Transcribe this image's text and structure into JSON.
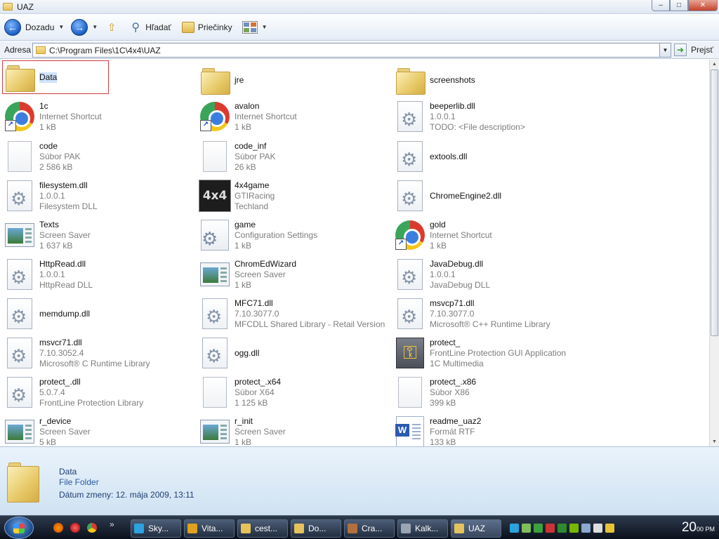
{
  "window": {
    "title": "UAZ"
  },
  "toolbar": {
    "back_label": "Dozadu",
    "search_label": "Hľadať",
    "folders_label": "Priečinky"
  },
  "address": {
    "label": "Adresa",
    "path": "C:\\Program Files\\1C\\4x4\\UAZ",
    "go_label": "Prejsť"
  },
  "items": [
    {
      "name": "Data",
      "l2": "",
      "l3": "",
      "icon": "folder-icon",
      "selected": true
    },
    {
      "name": "jre",
      "l2": "",
      "l3": "",
      "icon": "folder-icon"
    },
    {
      "name": "screenshots",
      "l2": "",
      "l3": "",
      "icon": "folder-icon"
    },
    {
      "name": "1c",
      "l2": "Internet Shortcut",
      "l3": "1 kB",
      "icon": "chrome-shortcut-icon"
    },
    {
      "name": "avalon",
      "l2": "Internet Shortcut",
      "l3": "1 kB",
      "icon": "chrome-shortcut-icon"
    },
    {
      "name": "beeperlib.dll",
      "l2": "1.0.0.1",
      "l3": "TODO: <File description>",
      "icon": "dll-icon"
    },
    {
      "name": "code",
      "l2": "Súbor PAK",
      "l3": "2 586 kB",
      "icon": "blank-file-icon"
    },
    {
      "name": "code_inf",
      "l2": "Súbor PAK",
      "l3": "26 kB",
      "icon": "blank-file-icon"
    },
    {
      "name": "extools.dll",
      "l2": "",
      "l3": "",
      "icon": "dll-icon"
    },
    {
      "name": "filesystem.dll",
      "l2": "1.0.0.1",
      "l3": "Filesystem DLL",
      "icon": "dll-icon"
    },
    {
      "name": "4x4game",
      "l2": "GTIRacing",
      "l3": "Techland",
      "icon": "game-4x4-icon"
    },
    {
      "name": "ChromeEngine2.dll",
      "l2": "",
      "l3": "",
      "icon": "dll-icon"
    },
    {
      "name": "Texts",
      "l2": "Screen Saver",
      "l3": "1 637 kB",
      "icon": "screensaver-icon"
    },
    {
      "name": "game",
      "l2": "Configuration Settings",
      "l3": "1 kB",
      "icon": "config-icon"
    },
    {
      "name": "gold",
      "l2": "Internet Shortcut",
      "l3": "1 kB",
      "icon": "chrome-shortcut-icon"
    },
    {
      "name": "HttpRead.dll",
      "l2": "1.0.0.1",
      "l3": "HttpRead DLL",
      "icon": "dll-icon"
    },
    {
      "name": "ChromEdWizard",
      "l2": "Screen Saver",
      "l3": "1 kB",
      "icon": "screensaver-icon"
    },
    {
      "name": "JavaDebug.dll",
      "l2": "1.0.0.1",
      "l3": "JavaDebug DLL",
      "icon": "dll-icon"
    },
    {
      "name": "memdump.dll",
      "l2": "",
      "l3": "",
      "icon": "dll-icon"
    },
    {
      "name": "MFC71.dll",
      "l2": "7.10.3077.0",
      "l3": "MFCDLL Shared Library - Retail Version",
      "icon": "dll-icon"
    },
    {
      "name": "msvcp71.dll",
      "l2": "7.10.3077.0",
      "l3": "Microsoft® C++ Runtime Library",
      "icon": "dll-icon"
    },
    {
      "name": "msvcr71.dll",
      "l2": "7.10.3052.4",
      "l3": "Microsoft® C Runtime Library",
      "icon": "dll-icon"
    },
    {
      "name": "ogg.dll",
      "l2": "",
      "l3": "",
      "icon": "dll-icon"
    },
    {
      "name": "protect_",
      "l2": "FrontLine Protection GUI Application",
      "l3": "1C Multimedia",
      "icon": "key-app-icon"
    },
    {
      "name": "protect_.dll",
      "l2": "5.0.7.4",
      "l3": "FrontLine Protection Library",
      "icon": "dll-icon"
    },
    {
      "name": "protect_.x64",
      "l2": "Súbor X64",
      "l3": "1 125 kB",
      "icon": "blank-file-icon"
    },
    {
      "name": "protect_.x86",
      "l2": "Súbor X86",
      "l3": "399 kB",
      "icon": "blank-file-icon"
    },
    {
      "name": "r_device",
      "l2": "Screen Saver",
      "l3": "5 kB",
      "icon": "screensaver-icon"
    },
    {
      "name": "r_init",
      "l2": "Screen Saver",
      "l3": "1 kB",
      "icon": "screensaver-icon"
    },
    {
      "name": "readme_uaz2",
      "l2": "Formát RTF",
      "l3": "133 kB",
      "icon": "word-document-icon"
    }
  ],
  "details": {
    "name": "Data",
    "type": "File Folder",
    "date": "Dátum zmeny: 12. mája 2009, 13:11"
  },
  "taskbar": {
    "tasks": [
      {
        "label": "Sky...",
        "color": "#2aa3e0"
      },
      {
        "label": "Vita...",
        "color": "#e0a020"
      },
      {
        "label": "cest...",
        "color": "#e6c25a"
      },
      {
        "label": "Do...",
        "color": "#e6c25a"
      },
      {
        "label": "Cra...",
        "color": "#b07040"
      },
      {
        "label": "Kalk...",
        "color": "#9aa4b2"
      },
      {
        "label": "UAZ",
        "color": "#e6c25a",
        "active": true
      }
    ],
    "more_label": "»",
    "clock": "20",
    "clock_suffix": "00 PM"
  }
}
